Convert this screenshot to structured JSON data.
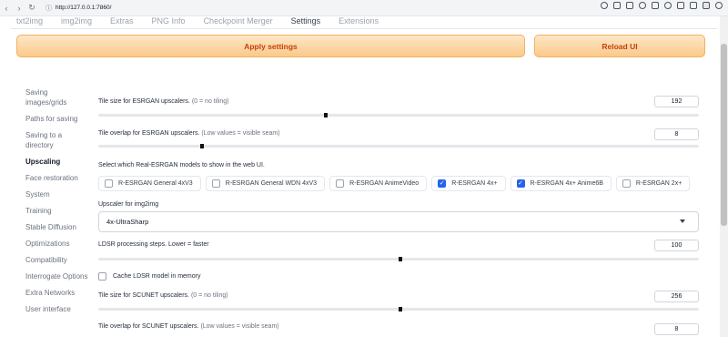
{
  "browser": {
    "url": "http://127.0.0.1:7860/",
    "nav": [
      "‹",
      "›",
      "↻",
      "⌂"
    ]
  },
  "tabs": [
    "txt2img",
    "img2img",
    "Extras",
    "PNG Info",
    "Checkpoint Merger",
    "Settings",
    "Extensions"
  ],
  "active_tab": "Settings",
  "buttons": {
    "apply": "Apply settings",
    "reload": "Reload UI"
  },
  "sidebar": {
    "items": [
      "Saving images/grids",
      "Paths for saving",
      "Saving to a directory",
      "Upscaling",
      "Face restoration",
      "System",
      "Training",
      "Stable Diffusion",
      "Optimizations",
      "Compatibility",
      "Interrogate Options",
      "Extra Networks",
      "User interface"
    ],
    "active": "Upscaling"
  },
  "settings": {
    "esrgan_tile": {
      "label": "Tile size for ESRGAN upscalers.",
      "hint": "(0 = no tiling)",
      "value": "192",
      "fraction": 0.375
    },
    "esrgan_overlap": {
      "label": "Tile overlap for ESRGAN upscalers.",
      "hint": "(Low values = visible seam)",
      "value": "8",
      "fraction": 0.17
    },
    "realesrgan": {
      "label": "Select which Real-ESRGAN models to show in the web UI.",
      "options": [
        {
          "label": "R-ESRGAN General 4xV3",
          "checked": false
        },
        {
          "label": "R-ESRGAN General WDN 4xV3",
          "checked": false
        },
        {
          "label": "R-ESRGAN AnimeVideo",
          "checked": false
        },
        {
          "label": "R-ESRGAN 4x+",
          "checked": true
        },
        {
          "label": "R-ESRGAN 4x+ Anime6B",
          "checked": true
        },
        {
          "label": "R-ESRGAN 2x+",
          "checked": false
        }
      ]
    },
    "upscaler_img2img": {
      "label": "Upscaler for img2img",
      "value": "4x-UltraSharp"
    },
    "ldsr_steps": {
      "label": "LDSR processing steps. Lower = faster",
      "value": "100",
      "fraction": 0.5
    },
    "ldsr_cache": {
      "label": "Cache LDSR model in memory",
      "checked": false
    },
    "scunet_tile": {
      "label": "Tile size for SCUNET upscalers.",
      "hint": "(0 = no tiling)",
      "value": "256",
      "fraction": 0.5
    },
    "scunet_overlap": {
      "label": "Tile overlap for SCUNET upscalers.",
      "hint": "(Low values = visible seam)",
      "value": "8"
    }
  },
  "colors": {
    "accent": "#f97316",
    "checkbox": "#2563eb"
  }
}
